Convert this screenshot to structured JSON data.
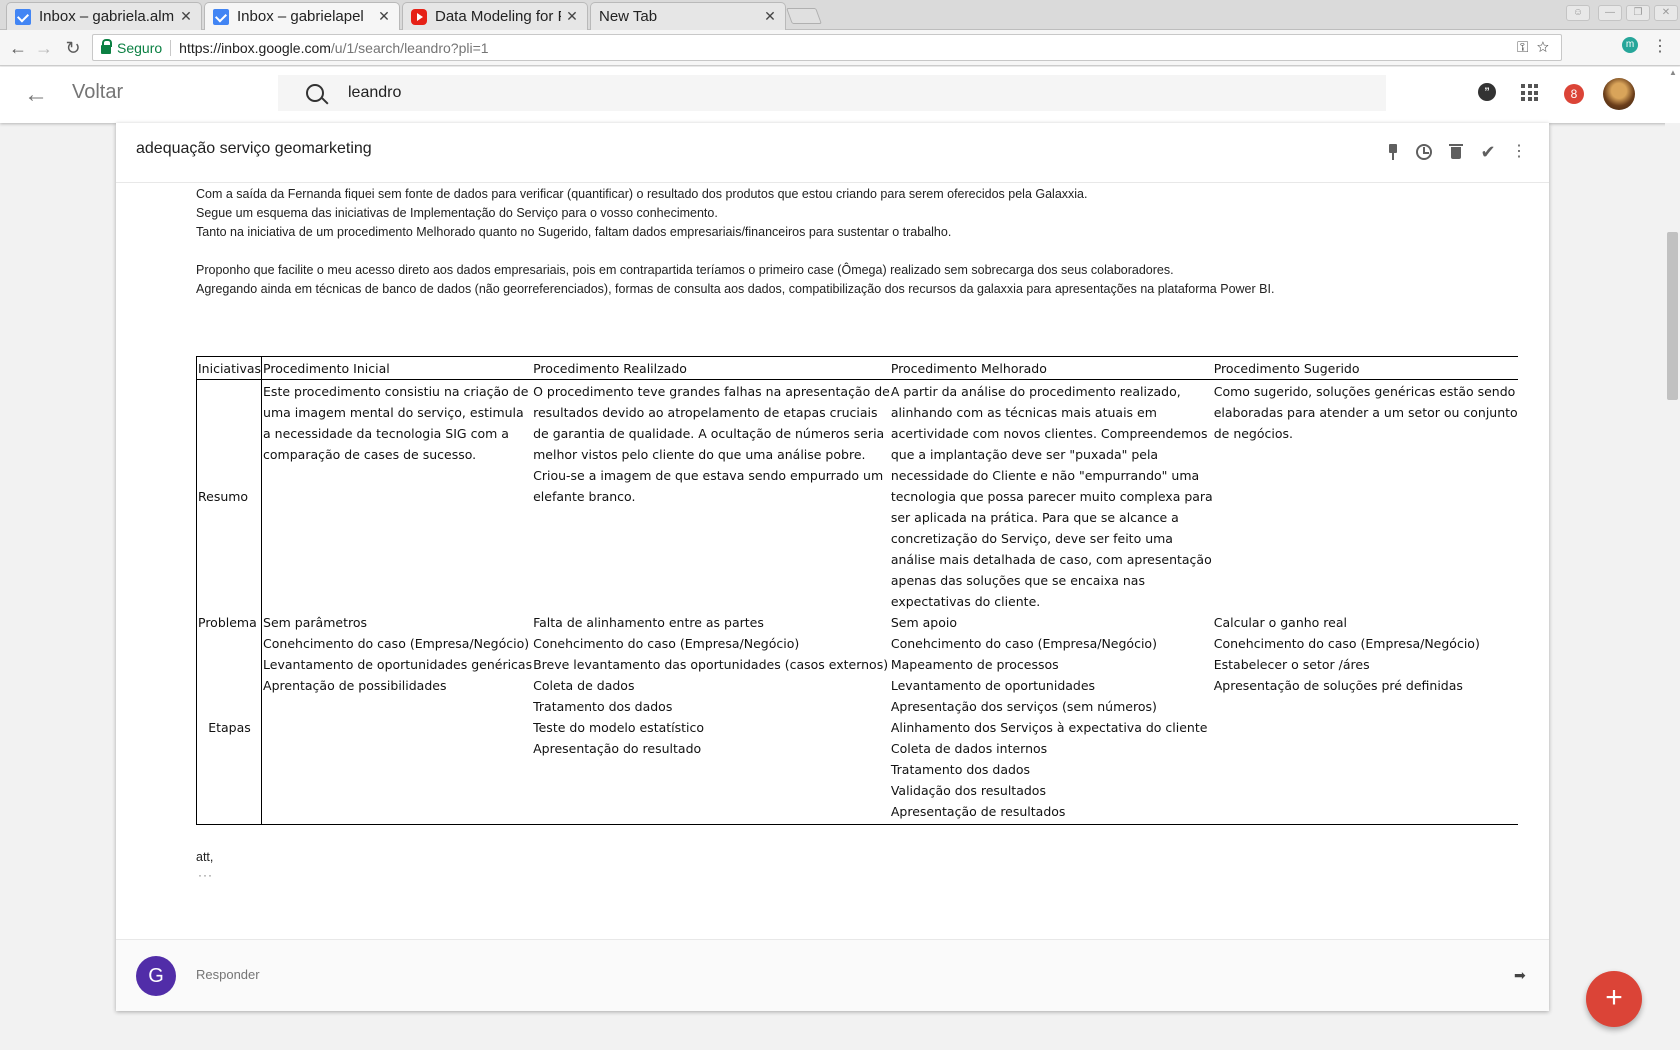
{
  "browser": {
    "tabs": [
      {
        "title": "Inbox – gabriela.alm",
        "icon": "inbox-favicon",
        "active": false
      },
      {
        "title": "Inbox – gabrielapel",
        "icon": "inbox-favicon",
        "active": true
      },
      {
        "title": "Data Modeling for F",
        "icon": "youtube-favicon",
        "active": false
      },
      {
        "title": "New Tab",
        "icon": "none",
        "active": false
      }
    ],
    "secure_label": "Seguro",
    "url_host": "https://inbox.google.com",
    "url_path": "/u/1/search/leandro?pli=1",
    "extension_letter": "m"
  },
  "header": {
    "back_label": "Voltar",
    "search_query": "leandro",
    "notification_count": "8"
  },
  "email": {
    "subject": "adequação serviço geomarketing",
    "paragraphs": [
      "Com a saída da Fernanda fiquei sem fonte de dados para verificar (quantificar) o resultado dos produtos que estou criando para serem oferecidos pela Galaxxia.",
      "Segue um esquema das iniciativas de Implementação do Serviço para o vosso conhecimento.",
      "Tanto na iniciativa de um procedimento Melhorado quanto no Sugerido, faltam dados empresariais/financeiros para sustentar o trabalho.",
      "Proponho que facilite o meu acesso direto aos dados empresariais, pois em contrapartida teríamos o primeiro case (Ômega) realizado sem sobrecarga dos seus colaboradores.",
      "Agregando ainda em técnicas de banco de dados (não georreferenciados), formas de consulta aos dados, compatibilização dos recursos da galaxxia para apresentações na plataforma Power BI."
    ],
    "table": {
      "headers": [
        "Iniciativas",
        "Procedimento Inicial",
        "Procedimento Realilzado",
        "Procedimento Melhorado",
        "Procedimento Sugerido"
      ],
      "rows": {
        "resumo": {
          "label": "Resumo",
          "cells": [
            [
              "Este procedimento consistiu na criação de",
              "uma imagem mental do serviço, estimula",
              "a necessidade da tecnologia SIG com a",
              "comparação de cases de sucesso."
            ],
            [
              "O procedimento teve grandes falhas na apresentação de",
              "resultados devido ao atropelamento de etapas cruciais",
              "de garantia de qualidade. A ocultação de números seria",
              "melhor vistos pelo cliente do que uma análise pobre.",
              "Criou-se a imagem de que estava sendo empurrado um",
              "elefante branco."
            ],
            [
              "A partir da análise do procedimento realizado,",
              "alinhando com as técnicas mais atuais em",
              "acertividade com novos clientes. Compreendemos",
              "que a implantação deve ser \"puxada\" pela",
              "necessidade do Cliente e não \"empurrando\" uma",
              "tecnologia que possa parecer muito complexa para",
              "ser aplicada na prática. Para que se alcance a",
              "concretização do Serviço, deve ser feito uma",
              "análise mais detalhada de caso, com apresentação",
              "apenas das soluções que se encaixa nas",
              "expectativas do cliente."
            ],
            [
              "Como sugerido, soluções genéricas estão sendo",
              "elaboradas para atender a um setor ou conjunto",
              "de negócios."
            ]
          ]
        },
        "problema": {
          "label": "Problema",
          "cells": [
            "Sem parâmetros",
            "Falta de alinhamento entre as partes",
            "Sem apoio",
            "Calcular o ganho real"
          ]
        },
        "etapas": {
          "label": "Etapas",
          "cells": [
            [
              "Conehcimento do caso (Empresa/Negócio)",
              "Levantamento de oportunidades genéricas",
              "Aprentação de possibilidades"
            ],
            [
              "Conehcimento do caso (Empresa/Negócio)",
              "Breve levantamento das oportunidades (casos externos)",
              "Coleta de dados",
              "Tratamento dos dados",
              "Teste do modelo estatístico",
              "Apresentação do resultado"
            ],
            [
              "Conehcimento do caso (Empresa/Negócio)",
              "Mapeamento de processos",
              "Levantamento de oportunidades",
              "Apresentação dos serviços (sem números)",
              "Alinhamento dos Serviços à expectativa do cliente",
              "Coleta de dados internos",
              "Tratamento dos dados",
              "Validação dos resultados",
              "Apresentação de resultados"
            ],
            [
              "Conehcimento do caso (Empresa/Negócio)",
              "Estabelecer o setor /áres",
              "Apresentação de soluções pré definidas"
            ]
          ]
        }
      }
    },
    "signoff": "att,",
    "quoted_ellipsis": "···"
  },
  "reply": {
    "avatar_letter": "G",
    "placeholder": "Responder"
  },
  "colors": {
    "accent_red": "#db4437",
    "reply_avatar": "#512da8",
    "secure_green": "#0b8043"
  }
}
